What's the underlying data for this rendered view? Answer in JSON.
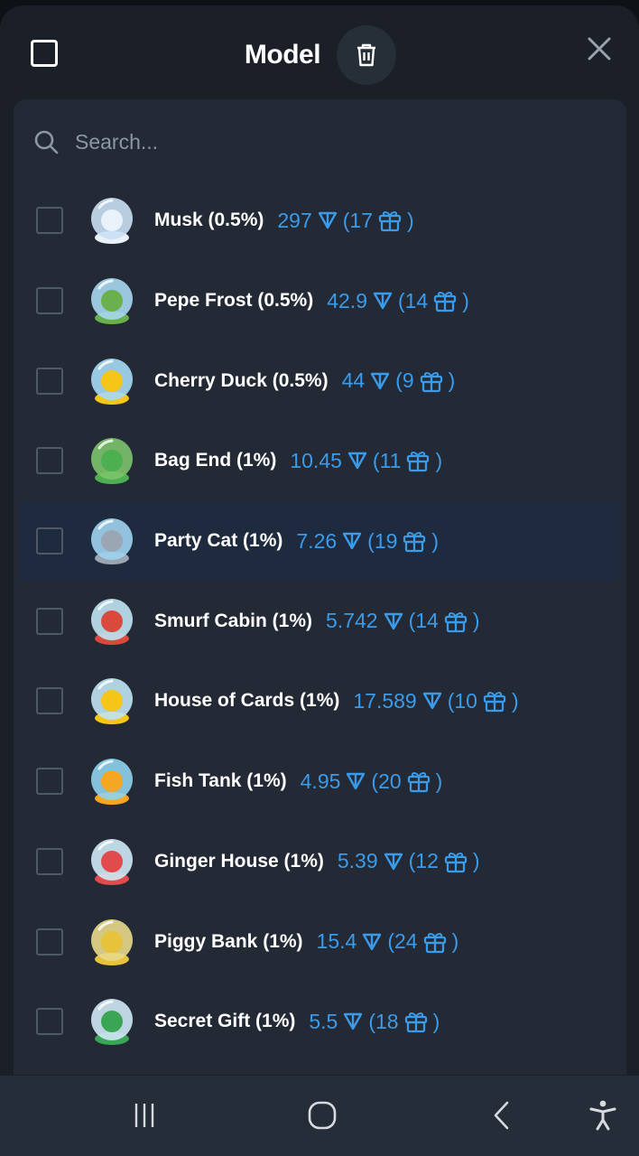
{
  "header": {
    "title": "Model"
  },
  "search": {
    "placeholder": "Search..."
  },
  "items": [
    {
      "name": "Musk (0.5%)",
      "price": "297",
      "count": "(17",
      "close": ")",
      "accent": "#e9f2fb",
      "ball": "#c9dff2"
    },
    {
      "name": "Pepe Frost (0.5%)",
      "price": "42.9",
      "count": "(14",
      "close": ")",
      "accent": "#6ab04c",
      "ball": "#a7d8f0"
    },
    {
      "name": "Cherry Duck (0.5%)",
      "price": "44",
      "count": "(9",
      "close": ")",
      "accent": "#f5c518",
      "ball": "#a6d9f5"
    },
    {
      "name": "Bag End (1%)",
      "price": "10.45",
      "count": "(11",
      "close": ")",
      "accent": "#4caf50",
      "ball": "#7cc36b"
    },
    {
      "name": "Party Cat (1%)",
      "price": "7.26",
      "count": "(19",
      "close": ")",
      "accent": "#9aa6b4",
      "ball": "#9fd3f0"
    },
    {
      "name": "Smurf Cabin (1%)",
      "price": "5.742",
      "count": "(14",
      "close": ")",
      "accent": "#d94a3d",
      "ball": "#bfe3f3"
    },
    {
      "name": "House of Cards (1%)",
      "price": "17.589",
      "count": "(10",
      "close": ")",
      "accent": "#f5c518",
      "ball": "#bfe3f3"
    },
    {
      "name": "Fish Tank (1%)",
      "price": "4.95",
      "count": "(20",
      "close": ")",
      "accent": "#f5a623",
      "ball": "#8fd3ee"
    },
    {
      "name": "Ginger House (1%)",
      "price": "5.39",
      "count": "(12",
      "close": ")",
      "accent": "#e24b4b",
      "ball": "#cfe9f6"
    },
    {
      "name": "Piggy Bank (1%)",
      "price": "15.4",
      "count": "(24",
      "close": ")",
      "accent": "#e6c33a",
      "ball": "#e8d98a"
    },
    {
      "name": "Secret Gift (1%)",
      "price": "5.5",
      "count": "(18",
      "close": ")",
      "accent": "#3aa655",
      "ball": "#cfe9f6"
    }
  ],
  "highlighted_index": 4,
  "colors": {
    "price_blue": "#3a9bea",
    "sheet": "#1b2028",
    "panel": "#232a35"
  },
  "icons": [
    "checkbox-icon",
    "trash-icon",
    "close-icon",
    "search-icon",
    "ton-diamond-icon",
    "gift-icon",
    "recents-icon",
    "home-icon",
    "back-icon",
    "accessibility-icon"
  ]
}
